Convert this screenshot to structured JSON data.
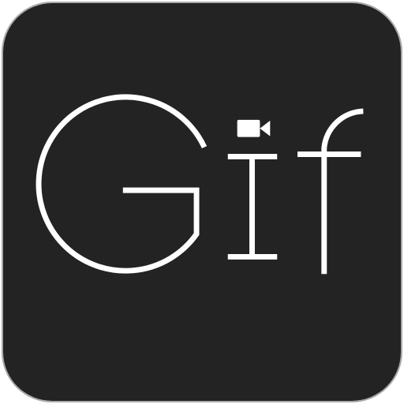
{
  "app_icon": {
    "wordmark": "Gif",
    "icon_name": "video-camera-icon",
    "colors": {
      "tile_background": "#232323",
      "tile_border": "#a9a9a9",
      "letter_color": "#ffffff",
      "camera_color": "#ffffff"
    }
  }
}
